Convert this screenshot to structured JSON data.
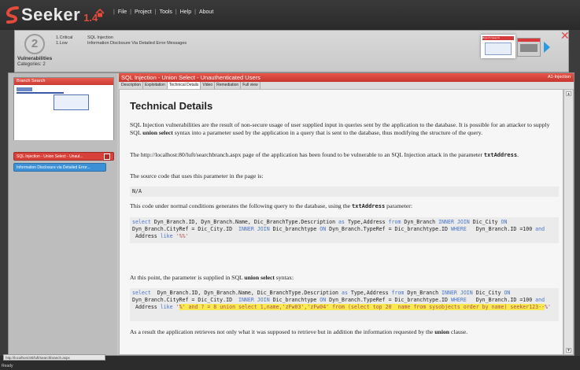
{
  "app": {
    "name": "Seeker",
    "version": "1.4"
  },
  "menu": {
    "items": [
      "File",
      "Project",
      "Tools",
      "Help",
      "About"
    ]
  },
  "summary": {
    "count": "2",
    "lines": [
      {
        "level": "1.Critical",
        "text": "SQL Injection"
      },
      {
        "level": "1.Low",
        "text": "Information Disclosure Via Detailed Error Messages"
      }
    ],
    "title": "Vulnerabilities",
    "categories": "Categories: 2"
  },
  "thumb": {
    "label": "Branch Search"
  },
  "sidebar": {
    "panel_title": "Branch Search",
    "items": [
      "SQL Injection - Union Select - Unaut...",
      "Information Disclosure via Detailed Error..."
    ]
  },
  "content": {
    "title": "SQL Injection - Union Select - Unauthenticated Users",
    "tag": "A1-Injection",
    "tabs": [
      "Description",
      "Exploitation",
      "Technical Details",
      "Video",
      "Remediation",
      "Full view"
    ],
    "heading": "Technical Details",
    "para1_a": "SQL Injection vulnerabilities are the result of non-secure usage of user supplied input in queries sent by the application to the database. It is possible for an attacker to supply SQL ",
    "para1_b": "union select",
    "para1_c": " syntax into a parameter used by the application in a query that is sent to the database, thus modifying the structure of the query.",
    "para2_a": "The http://localhost:80/luft/searchbranch.aspx page of the application has been found to be vulnerable to an SQL Injection attack in the parameter ",
    "para2_b": "txtAddress",
    "para2_c": ".",
    "para3": "The source code that uses this parameter in the page is:",
    "code_na": "N/A",
    "para4_a": "This code under normal conditions generates the following query to the database, using the ",
    "para4_b": "txtAddress",
    "para4_c": " parameter:",
    "para5_a": "At this point, the parameter is supplied in SQL ",
    "para5_b": "union select",
    "para5_c": " syntax:",
    "para6_a": "As a result the application retrieves not only what it was supposed to retrieve but in addition the information requested by the ",
    "para6_b": "union",
    "para6_c": " clause."
  },
  "status": {
    "url": "http://localhost:80/luft/searchbranch.aspx",
    "ready": "Ready"
  },
  "colors": {
    "accent_red": "#d8413a",
    "accent_blue": "#3c91d6",
    "highlight": "#f7e94f"
  }
}
